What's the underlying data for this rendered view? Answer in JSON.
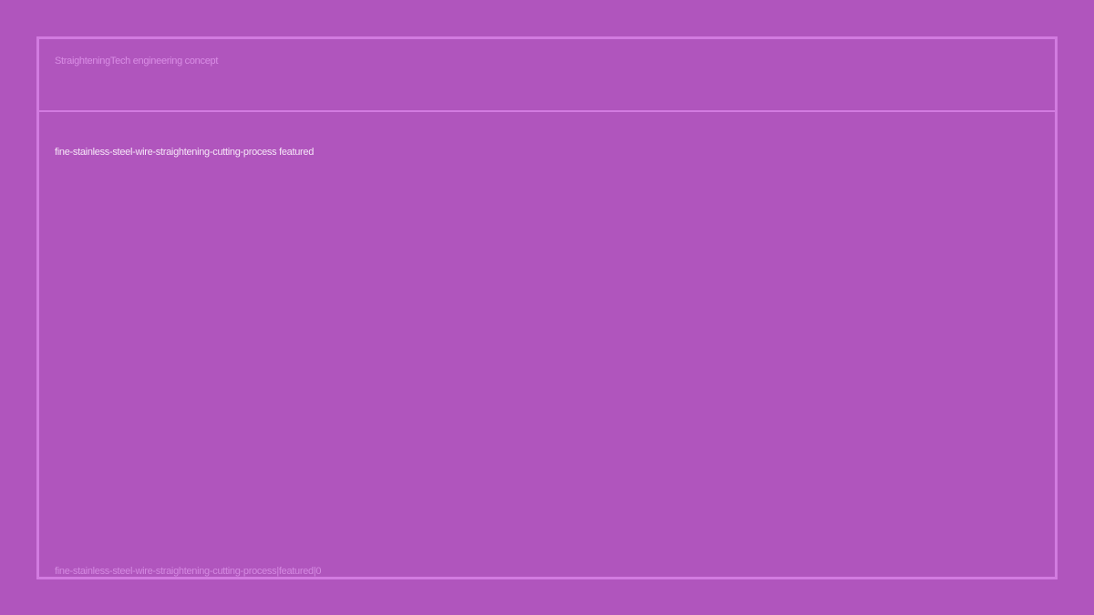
{
  "header": {
    "brand_text": "StraighteningTech engineering concept"
  },
  "main": {
    "title": "fine-stainless-steel-wire-straightening-cutting-process featured"
  },
  "footer": {
    "caption": "fine-stainless-steel-wire-straightening-cutting-process|featured|0"
  },
  "colors": {
    "background": "#b055bd",
    "frame_border": "#d27be0",
    "title_text": "#f6e6f8",
    "muted_text": "#d98ee5"
  }
}
